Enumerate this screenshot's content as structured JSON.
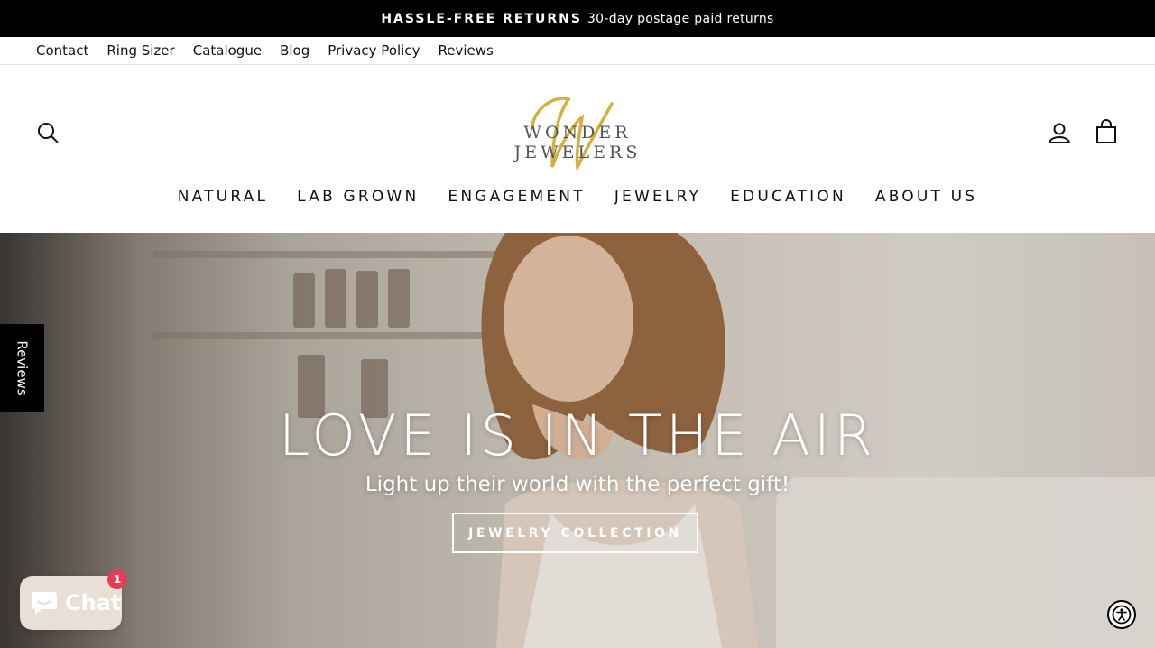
{
  "announcement": {
    "bold": "HASSLE-FREE RETURNS",
    "text": "30-day postage paid returns"
  },
  "utility_nav": [
    "Contact",
    "Ring Sizer",
    "Catalogue",
    "Blog",
    "Privacy Policy",
    "Reviews"
  ],
  "logo": {
    "text": "WONDER JEWELERS",
    "monogram": "W"
  },
  "header_icons": [
    "search-icon",
    "account-icon",
    "cart-icon"
  ],
  "main_nav": [
    "NATURAL",
    "LAB GROWN",
    "ENGAGEMENT",
    "JEWELRY",
    "EDUCATION",
    "ABOUT US"
  ],
  "hero": {
    "title": "LOVE IS IN THE AIR",
    "subtitle": "Light up their world with the perfect gift!",
    "button": "JEWELRY COLLECTION"
  },
  "reviews_tab": "Reviews",
  "chat": {
    "label": "Chat",
    "badge": "1"
  },
  "colors": {
    "announcement_bg": "#000000",
    "gold": "#d4b13a",
    "chat_badge": "#e83b56",
    "chat_bg": "#e9dfd6"
  }
}
